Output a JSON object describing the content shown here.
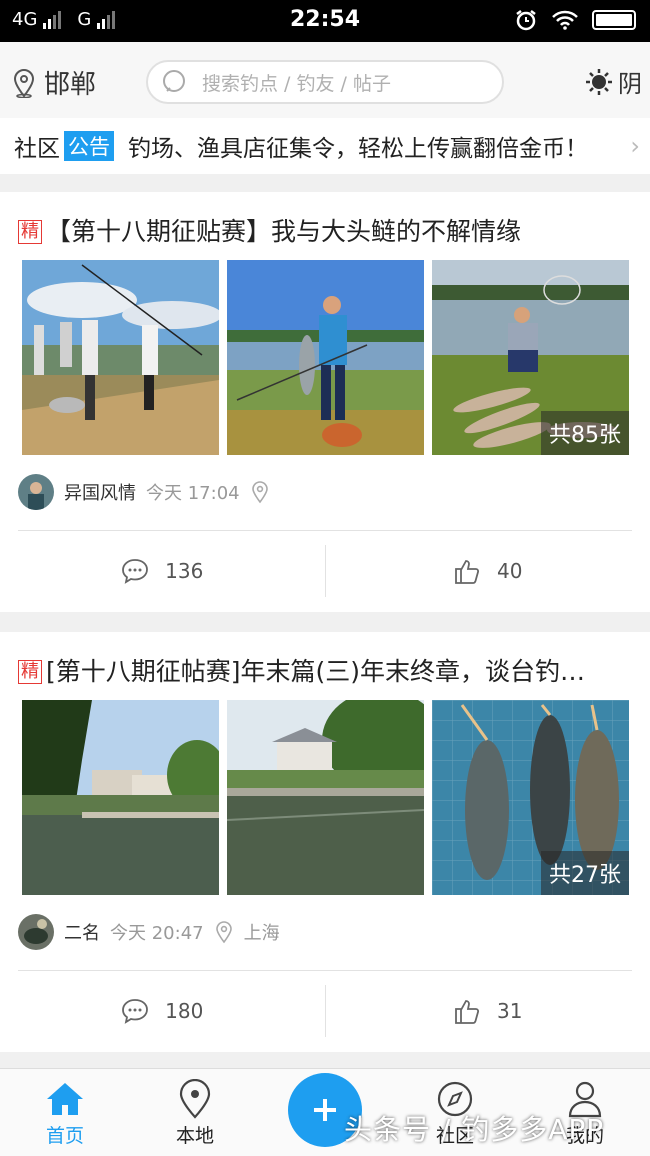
{
  "status_bar": {
    "signal_1": "4G",
    "signal_2": "G",
    "time": "22:54",
    "icons": [
      "alarm-icon",
      "wifi-icon",
      "battery-icon"
    ]
  },
  "header": {
    "city": "邯郸",
    "search_placeholder": "搜索钓点 / 钓友 / 帖子",
    "weather": "阴"
  },
  "notice": {
    "label": "社区",
    "tag": "公告",
    "text": "钓场、渔具店征集令，轻松上传赢翻倍金币！"
  },
  "posts": [
    {
      "badge": "精",
      "title": "【第十八期征贴赛】我与大头鲢的不解情缘",
      "photo_count": "共85张",
      "author": "异国风情",
      "time": "今天 17:04",
      "location": "",
      "comments": "136",
      "likes": "40"
    },
    {
      "badge": "精",
      "title": "[第十八期征帖赛]年末篇(三)年末终章，谈台钓…",
      "photo_count": "共27张",
      "author": "二名",
      "time": "今天 20:47",
      "location": "上海",
      "comments": "180",
      "likes": "31"
    }
  ],
  "bottom_nav": {
    "home": "首页",
    "local": "本地",
    "community": "社区",
    "me": "我的",
    "active": "home"
  },
  "watermark": "头条号 / 钓多多APP",
  "colors": {
    "accent": "#1e9ef0",
    "badge_red": "#e53935"
  }
}
